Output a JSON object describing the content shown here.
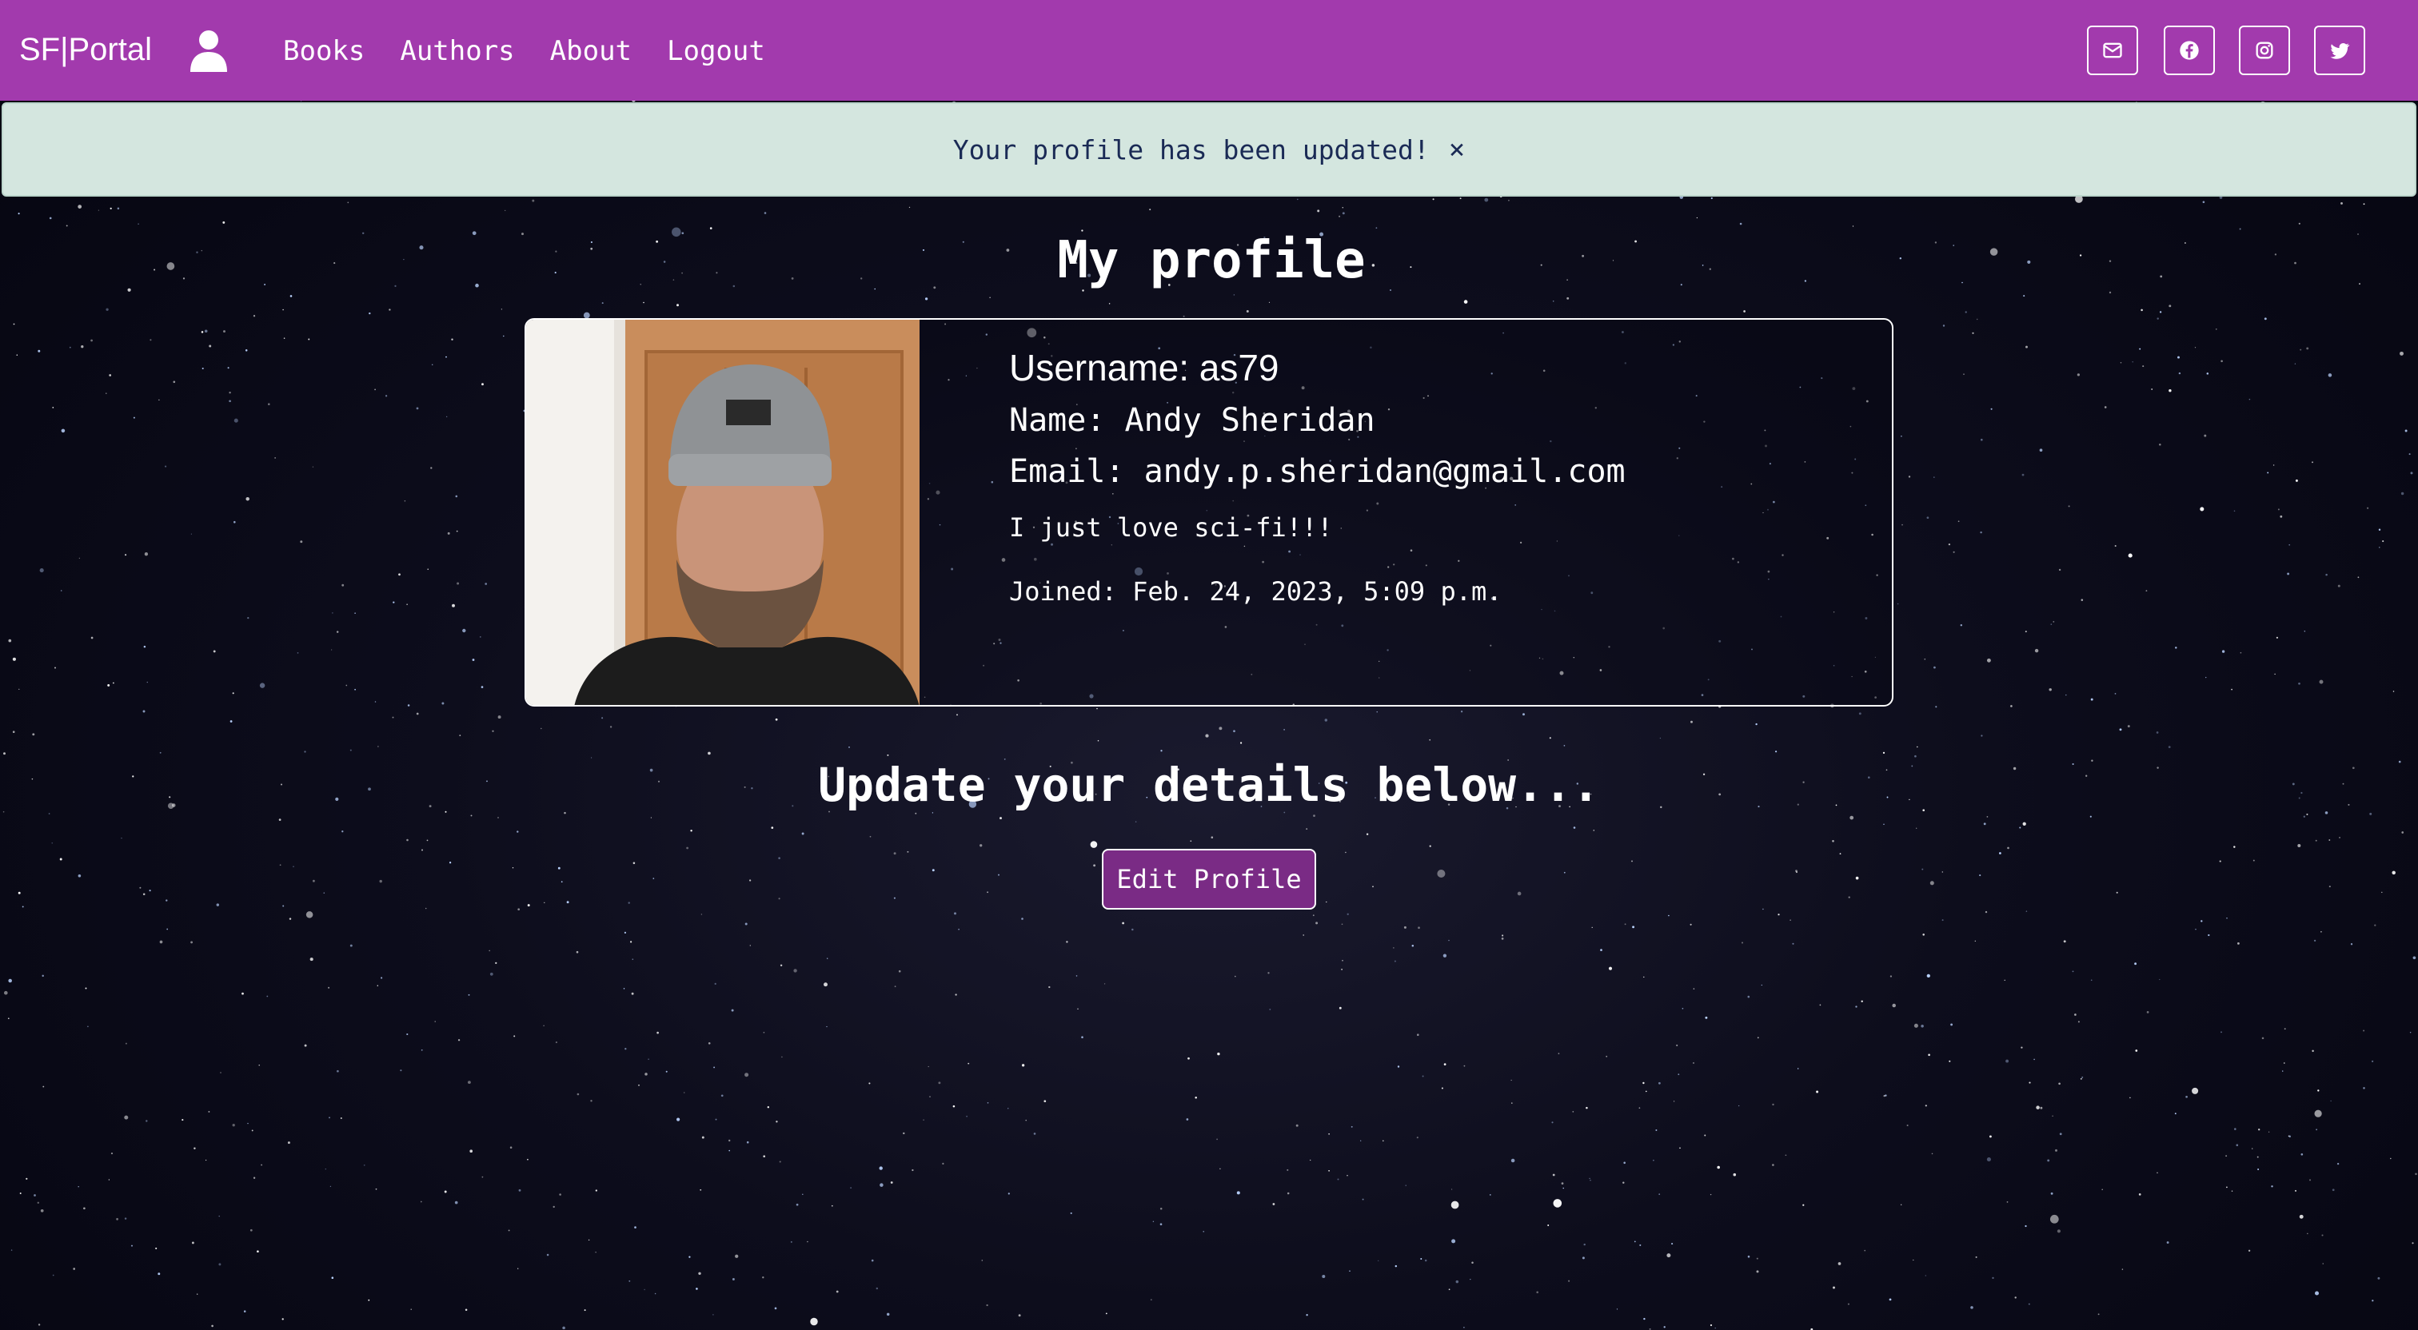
{
  "colors": {
    "navbar": "#a23aad",
    "alert_bg": "#d4e6df",
    "alert_text": "#1a2a55",
    "button_bg": "#7a2b85",
    "background": "#0d0d1c"
  },
  "navbar": {
    "brand": "SF|Portal",
    "user_icon": "user-icon",
    "links": [
      {
        "label": "Books"
      },
      {
        "label": "Authors"
      },
      {
        "label": "About"
      },
      {
        "label": "Logout"
      }
    ],
    "social_icons": [
      "envelope-icon",
      "facebook-icon",
      "instagram-icon",
      "twitter-icon"
    ]
  },
  "alert": {
    "message": "Your profile has been updated!",
    "close": "×"
  },
  "page": {
    "title": "My profile",
    "subtitle": "Update your details below...",
    "edit_button": "Edit Profile"
  },
  "profile": {
    "username": "Username: as79",
    "name": "Name: Andy Sheridan",
    "email": "Email: andy.p.sheridan@gmail.com",
    "bio": "I just love sci-fi!!!",
    "joined": "Joined: Feb. 24, 2023, 5:09 p.m."
  }
}
